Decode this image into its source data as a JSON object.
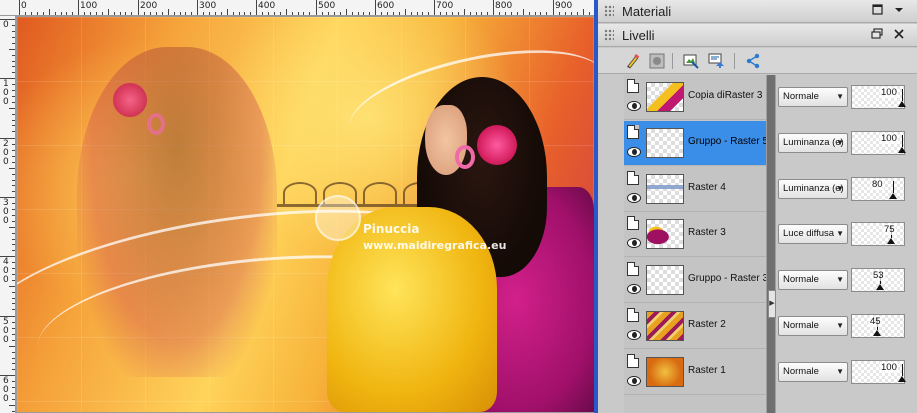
{
  "ruler": {
    "h_labels": [
      "0",
      "100",
      "200",
      "300",
      "400",
      "500",
      "600",
      "700",
      "800",
      "900"
    ],
    "v_labels": [
      "0",
      "100",
      "200",
      "300",
      "400",
      "500",
      "600"
    ]
  },
  "canvas": {
    "watermark_line1": "Pinuccia",
    "watermark_line2": "www.maidiregrafica.eu"
  },
  "panels": {
    "materiali": {
      "title": "Materiali"
    },
    "livelli": {
      "title": "Livelli"
    }
  },
  "layers": [
    {
      "name": "Copia diRaster 3",
      "blend": "Normale",
      "opacity": 100,
      "selected": false,
      "thumb": "woman"
    },
    {
      "name": "Gruppo - Raster 5",
      "blend": "Luminanza (e)",
      "opacity": 100,
      "selected": true,
      "thumb": "empty"
    },
    {
      "name": "Raster 4",
      "blend": "Luminanza (e)",
      "opacity": 80,
      "selected": false,
      "thumb": "bridge"
    },
    {
      "name": "Raster 3",
      "blend": "Luce diffusa",
      "opacity": 75,
      "selected": false,
      "thumb": "woman-small"
    },
    {
      "name": "Gruppo - Raster 3",
      "blend": "Normale",
      "opacity": 53,
      "selected": false,
      "thumb": "empty"
    },
    {
      "name": "Raster 2",
      "blend": "Normale",
      "opacity": 45,
      "selected": false,
      "thumb": "pattern"
    },
    {
      "name": "Raster 1",
      "blend": "Normale",
      "opacity": 100,
      "selected": false,
      "thumb": "orange"
    }
  ],
  "colors": {
    "selection": "#3a8ee8",
    "canvas_border": "#2a58c8"
  }
}
